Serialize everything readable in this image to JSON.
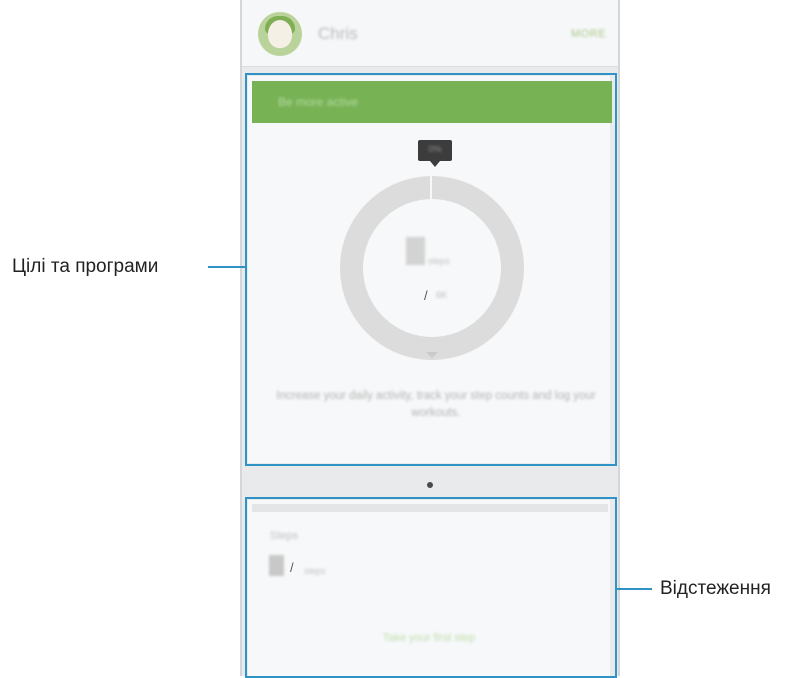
{
  "header": {
    "username": "Chris",
    "more_label": "MORE"
  },
  "goals_card": {
    "banner_title": "Be more active",
    "tooltip_value": "0%",
    "steps_unit": "steps",
    "goal_value": "6K",
    "description": "Increase your daily activity, track your step counts and log your workouts."
  },
  "tracker_card": {
    "title": "Steps",
    "count_unit": "steps",
    "first_steps_link": "Take your first step"
  },
  "callouts": {
    "goals_and_programs": "Цілі та програми",
    "trackers": "Відстеження"
  },
  "colors": {
    "accent": "#77b255",
    "highlight": "#2f93c6"
  },
  "icons": {
    "pager_dot": "dot-icon",
    "avatar": "avatar-icon"
  }
}
